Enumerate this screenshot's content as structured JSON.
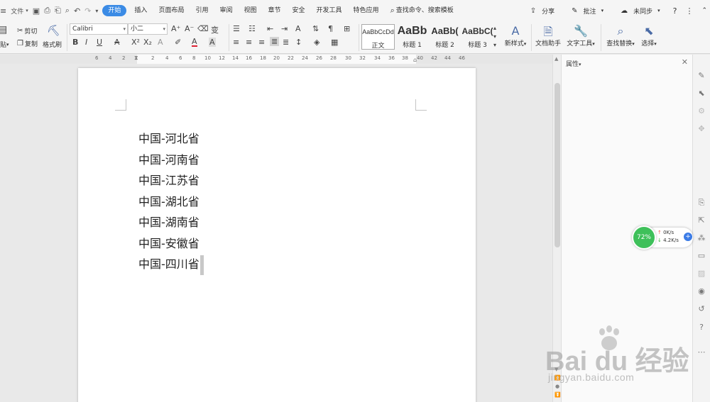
{
  "menubar": {
    "file_label": "文件",
    "tabs": [
      "开始",
      "插入",
      "页面布局",
      "引用",
      "审阅",
      "视图",
      "章节",
      "安全",
      "开发工具",
      "特色应用"
    ],
    "active_tab": "开始",
    "search_label": "查找命令、搜索模板",
    "share_label": "分享",
    "comment_label": "批注",
    "sync_label": "未同步",
    "help_label": "?",
    "more_label": "⋮"
  },
  "ribbon": {
    "paste_label": "贴",
    "cut_label": "剪切",
    "copy_label": "复制",
    "format_painter_label": "格式刷",
    "font_name": "Calibri",
    "font_size": "小二",
    "styles": [
      {
        "sample": "AaBbCcDd",
        "label": "正文"
      },
      {
        "sample": "AaBb",
        "label": "标题 1"
      },
      {
        "sample": "AaBb(",
        "label": "标题 2"
      },
      {
        "sample": "AaBbC(",
        "label": "标题 3"
      }
    ],
    "new_style_label": "新样式",
    "doc_helper_label": "文档助手",
    "text_tools_label": "文字工具",
    "find_replace_label": "查找替换",
    "select_label": "选择"
  },
  "ruler": {
    "ticks": [
      "6",
      "4",
      "2",
      "2",
      "4",
      "6",
      "8",
      "10",
      "12",
      "14",
      "16",
      "18",
      "20",
      "22",
      "24",
      "26",
      "28",
      "30",
      "32",
      "34",
      "36",
      "38",
      "40",
      "42",
      "44",
      "46"
    ]
  },
  "document": {
    "lines": [
      "中国-河北省",
      "中国-河南省",
      "中国-江苏省",
      "中国-湖北省",
      "中国-湖南省",
      "中国-安徽省",
      "中国-四川省"
    ]
  },
  "properties": {
    "title": "属性"
  },
  "network": {
    "percent": "72%",
    "upload": "0K/s",
    "download": "4.2K/s"
  },
  "watermark": {
    "logo": "Bai  du 经验",
    "url": "jingyan.baidu.com"
  },
  "colors": {
    "accent": "#3b8be5",
    "net_green": "#3ec05a"
  }
}
